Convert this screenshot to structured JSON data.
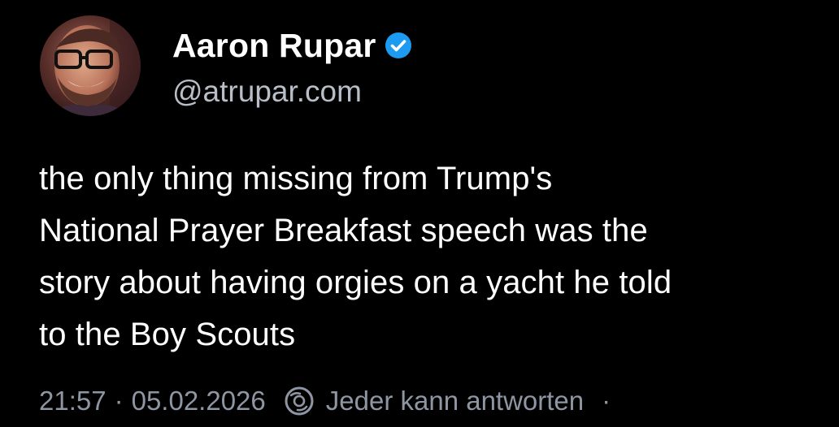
{
  "post": {
    "author": {
      "display_name": "Aaron Rupar",
      "handle": "@atrupar.com",
      "verified": true,
      "verified_icon": "verified-check-icon",
      "avatar_icon": "avatar"
    },
    "text": "the only thing missing from Trump's\nNational Prayer Breakfast speech was the\nstory about having orgies on a yacht he told\nto the Boy Scouts",
    "meta": {
      "time": "21:57",
      "separator": "·",
      "date": "05.02.2026",
      "reply_settings_icon": "reply-settings-icon",
      "reply_settings": "Jeder kann antworten",
      "trailing_separator": "·"
    }
  },
  "colors": {
    "background": "#000000",
    "text": "#ffffff",
    "handle": "#b8bec7",
    "meta": "#8e96a3",
    "verified_blue": "#1d9bf0"
  }
}
